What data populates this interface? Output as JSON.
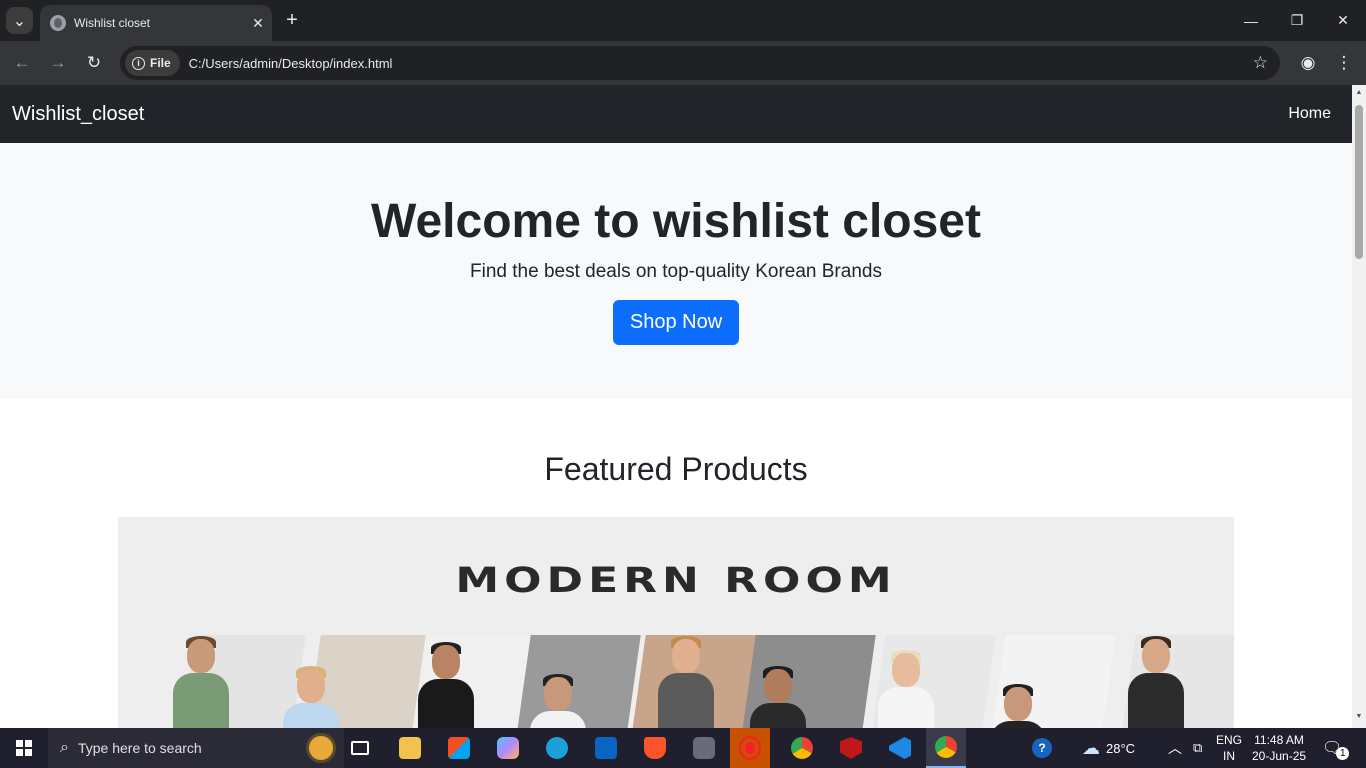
{
  "browser": {
    "tab_title": "Wishlist closet",
    "chip_label": "File",
    "url": "C:/Users/admin/Desktop/index.html"
  },
  "site": {
    "brand": "Wishlist_closet",
    "nav_home": "Home"
  },
  "hero": {
    "title": "Welcome to wishlist closet",
    "subtitle": "Find the best deals on top-quality Korean Brands",
    "cta": "Shop Now"
  },
  "featured": {
    "heading": "Featured Products",
    "banner_logo": "MODERN ROOM"
  },
  "taskbar": {
    "search_placeholder": "Type here to search",
    "temperature": "28°C",
    "lang_top": "ENG",
    "lang_bottom": "IN",
    "time": "11:48 AM",
    "date": "20-Jun-25",
    "notification_count": "1",
    "weather_badge": "1"
  },
  "colors": {
    "primary": "#0d6efd",
    "navbar": "#212529",
    "hero_bg": "#f8f9fa"
  }
}
